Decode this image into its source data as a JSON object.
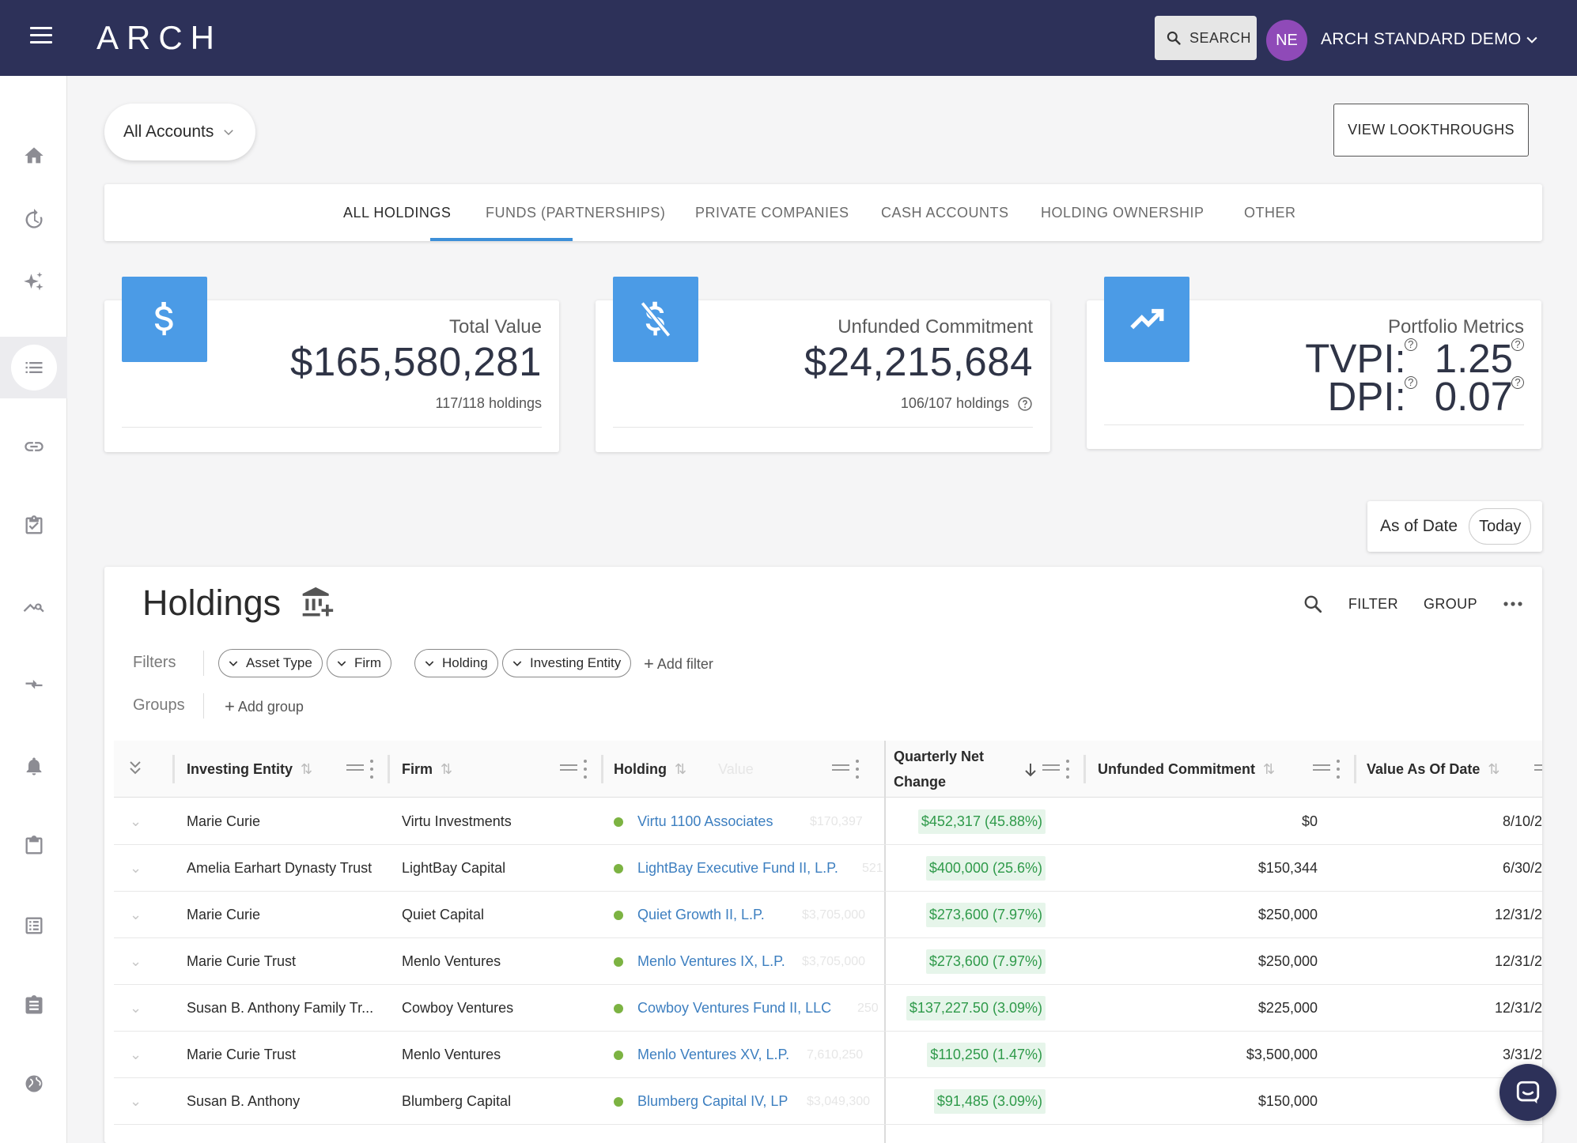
{
  "header": {
    "logo": "ARCH",
    "search_label": "SEARCH",
    "avatar_initials": "NE",
    "account_name": "ARCH STANDARD DEMO"
  },
  "sidenav": {
    "items": [
      {
        "icon": "home-icon",
        "active": false
      },
      {
        "icon": "history-icon",
        "active": false
      },
      {
        "icon": "sparkle-icon",
        "active": false
      },
      {
        "icon": "list-icon",
        "active": true
      },
      {
        "icon": "link-icon",
        "active": false
      },
      {
        "icon": "clipboard-check-icon",
        "active": false
      },
      {
        "icon": "chart-search-icon",
        "active": false
      },
      {
        "icon": "compare-arrows-icon",
        "active": false
      },
      {
        "icon": "bell-icon",
        "active": false
      },
      {
        "icon": "clipboard-icon",
        "active": false
      },
      {
        "icon": "document-list-icon",
        "active": false
      },
      {
        "icon": "assignment-icon",
        "active": false
      },
      {
        "icon": "globe-icon",
        "active": false
      }
    ]
  },
  "accounts_select": "All Accounts",
  "lookthrough_button": "VIEW LOOKTHROUGHS",
  "tabs": [
    {
      "label": "ALL HOLDINGS",
      "active": true
    },
    {
      "label": "FUNDS (PARTNERSHIPS)",
      "active": false
    },
    {
      "label": "PRIVATE COMPANIES",
      "active": false
    },
    {
      "label": "CASH ACCOUNTS",
      "active": false
    },
    {
      "label": "HOLDING OWNERSHIP",
      "active": false
    },
    {
      "label": "OTHER",
      "active": false
    }
  ],
  "stats": {
    "total_value": {
      "label": "Total Value",
      "value": "$165,580,281",
      "sub": "117/118 holdings",
      "icon": "dollar-icon"
    },
    "unfunded": {
      "label": "Unfunded Commitment",
      "value": "$24,215,684",
      "sub": "106/107 holdings",
      "icon": "dollar-off-icon"
    },
    "portfolio": {
      "label": "Portfolio Metrics",
      "tvpi_label": "TVPI:",
      "tvpi_value": "1.25",
      "dpi_label": "DPI:",
      "dpi_value": "0.07",
      "icon": "trending-up-icon"
    }
  },
  "as_of": {
    "label": "As of Date",
    "value": "Today"
  },
  "holdings": {
    "title": "Holdings",
    "tools": {
      "filter": "FILTER",
      "group": "GROUP"
    },
    "filters_label": "Filters",
    "groups_label": "Groups",
    "filter_chips": [
      "Asset Type",
      "Firm",
      "Holding",
      "Investing Entity"
    ],
    "add_filter": "Add filter",
    "add_group": "Add group",
    "columns": {
      "investing_entity": "Investing Entity",
      "firm": "Firm",
      "holding": "Holding",
      "value_ghost": "Value",
      "quarterly_line1": "Quarterly Net",
      "quarterly_line2": "Change",
      "unfunded": "Unfunded Commitment",
      "value_as_of": "Value As Of Date"
    },
    "rows": [
      {
        "entity": "Marie Curie",
        "firm": "Virtu Investments",
        "holding": "Virtu 1100 Associates",
        "ghost": "$170,397",
        "change": "$452,317 (45.88%)",
        "unfunded": "$0",
        "date": "8/10/2"
      },
      {
        "entity": "Amelia Earhart Dynasty Trust",
        "firm": "LightBay Capital",
        "holding": "LightBay Executive Fund II, L.P.",
        "ghost": "521",
        "change": "$400,000 (25.6%)",
        "unfunded": "$150,344",
        "date": "6/30/2"
      },
      {
        "entity": "Marie Curie",
        "firm": "Quiet Capital",
        "holding": "Quiet Growth II, L.P.",
        "ghost": "$3,705,000",
        "change": "$273,600 (7.97%)",
        "unfunded": "$250,000",
        "date": "12/31/2"
      },
      {
        "entity": "Marie Curie Trust",
        "firm": "Menlo Ventures",
        "holding": "Menlo Ventures IX, L.P.",
        "ghost": "$3,705,000",
        "change": "$273,600 (7.97%)",
        "unfunded": "$250,000",
        "date": "12/31/2"
      },
      {
        "entity": "Susan B. Anthony Family Tr...",
        "firm": "Cowboy Ventures",
        "holding": "Cowboy Ventures Fund II, LLC",
        "ghost": "250",
        "change": "$137,227.50 (3.09%)",
        "unfunded": "$225,000",
        "date": "12/31/2"
      },
      {
        "entity": "Marie Curie Trust",
        "firm": "Menlo Ventures",
        "holding": "Menlo Ventures XV, L.P.",
        "ghost": "7,610,250",
        "change": "$110,250 (1.47%)",
        "unfunded": "$3,500,000",
        "date": "3/31/2"
      },
      {
        "entity": "Susan B. Anthony",
        "firm": "Blumberg Capital",
        "holding": "Blumberg Capital IV, LP",
        "ghost": "$3,049,300",
        "change": "$91,485 (3.09%)",
        "unfunded": "$150,000",
        "date": "12/"
      }
    ]
  }
}
